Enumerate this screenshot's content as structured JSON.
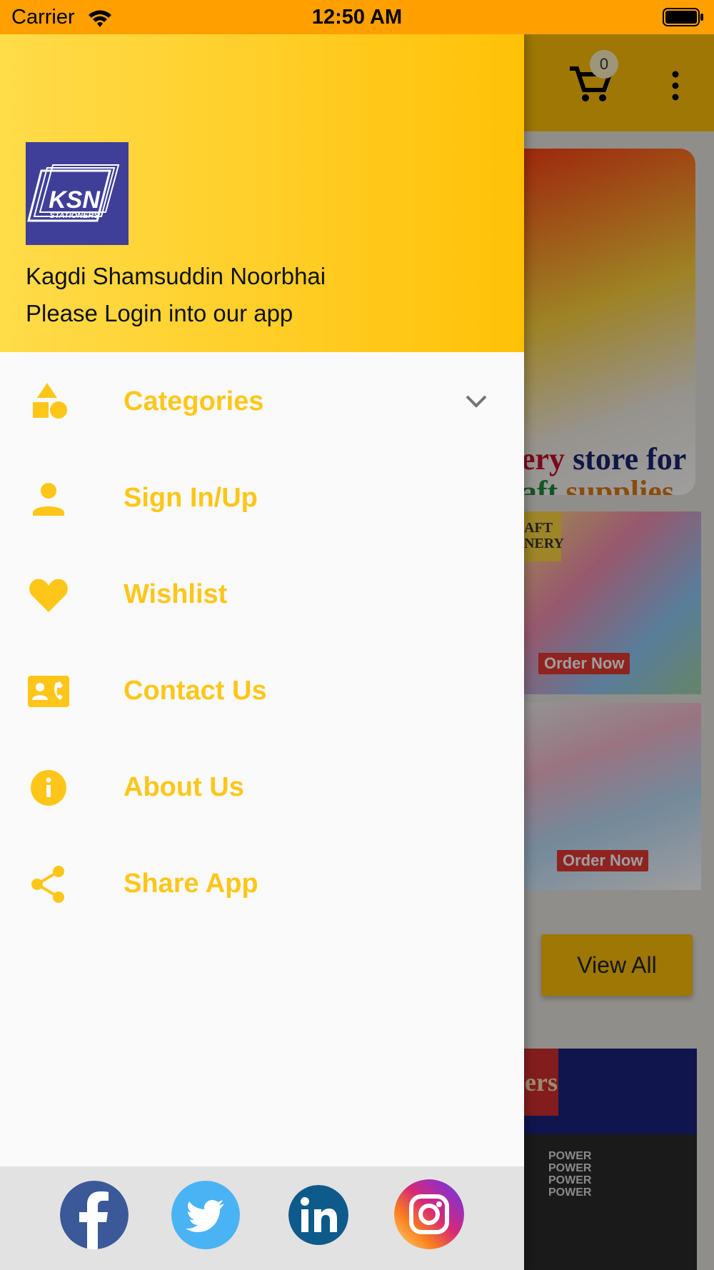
{
  "status_bar": {
    "carrier": "Carrier",
    "time": "12:50 AM"
  },
  "drawer": {
    "header": {
      "logo_text": "KSN",
      "logo_subtext": "STATIONERS",
      "company_name": "Kagdi Shamsuddin Noorbhai",
      "login_prompt": "Please Login into our app"
    },
    "menu": [
      {
        "label": "Categories",
        "icon": "categories-icon",
        "expandable": true
      },
      {
        "label": "Sign In/Up",
        "icon": "person-icon"
      },
      {
        "label": "Wishlist",
        "icon": "heart-icon"
      },
      {
        "label": "Contact Us",
        "icon": "contact-card-icon"
      },
      {
        "label": "About Us",
        "icon": "info-icon"
      },
      {
        "label": "Share App",
        "icon": "share-icon"
      }
    ],
    "social": [
      "facebook-icon",
      "twitter-icon",
      "linkedin-icon",
      "instagram-icon"
    ]
  },
  "background_app": {
    "cart_count": "0",
    "banner_text_line1_red": "ery",
    "banner_text_line1": " store for",
    "banner_text_line2_green": "aft",
    "banner_text_line2": " supplies",
    "tile1_order_label": "Order Now",
    "tile1_corner_text": "AFT",
    "tile1_corner_text2": "NERY",
    "tile2_order_label": "Order Now",
    "view_all_label": "View All",
    "product_banner_text": "ers",
    "product_label": "POWER"
  },
  "colors": {
    "status_bar": "#ffa000",
    "accent": "#ffc107",
    "menu_text": "#ffc61a",
    "logo_bg": "#3f3f9a"
  }
}
